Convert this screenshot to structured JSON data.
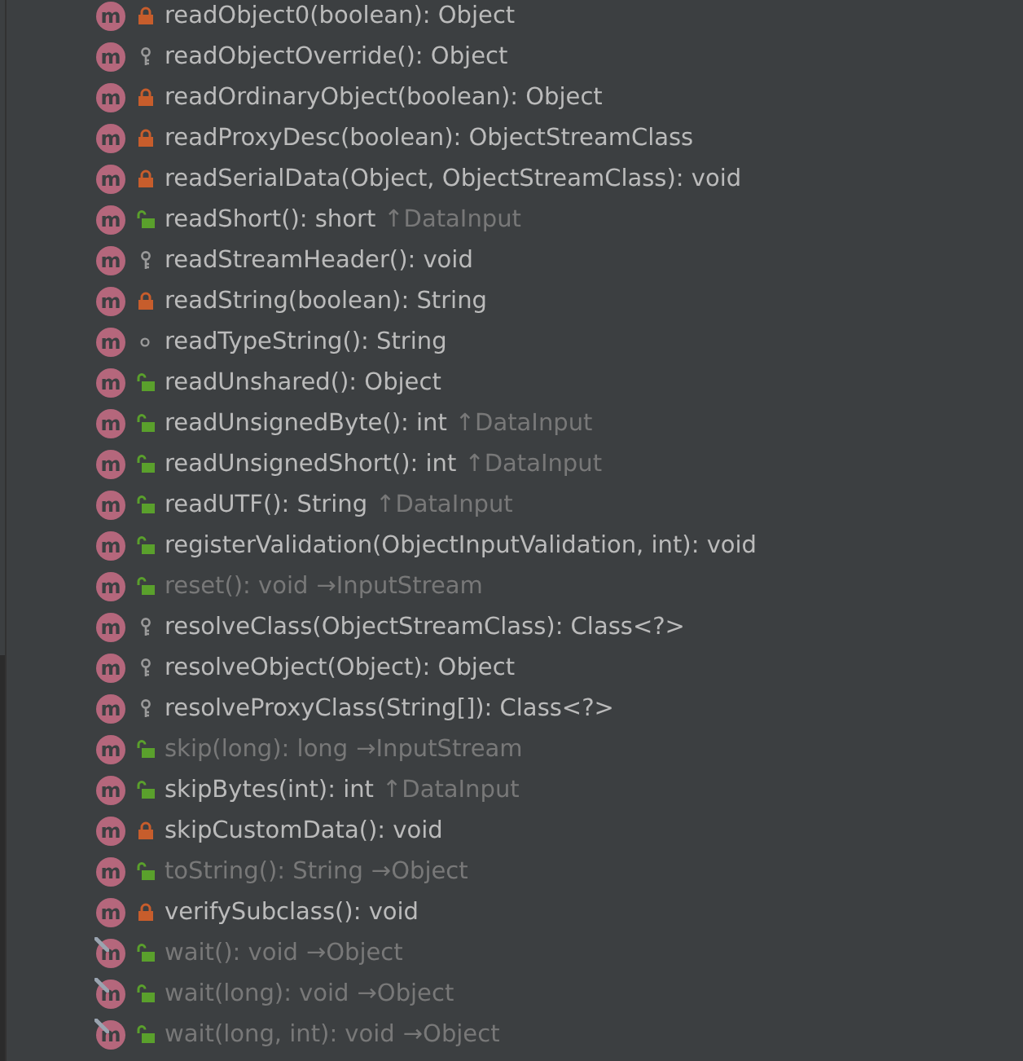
{
  "members": [
    {
      "badge": "m",
      "signature": "readObject0(boolean): Object",
      "kind": "private",
      "inherited": false,
      "final": false
    },
    {
      "badge": "m",
      "signature": "readObjectOverride(): Object",
      "kind": "protected",
      "inherited": false,
      "final": false
    },
    {
      "badge": "m",
      "signature": "readOrdinaryObject(boolean): Object",
      "kind": "private",
      "inherited": false,
      "final": false
    },
    {
      "badge": "m",
      "signature": "readProxyDesc(boolean): ObjectStreamClass",
      "kind": "private",
      "inherited": false,
      "final": false
    },
    {
      "badge": "m",
      "signature": "readSerialData(Object, ObjectStreamClass): void",
      "kind": "private",
      "inherited": false,
      "final": false
    },
    {
      "badge": "m",
      "signature": "readShort(): short",
      "origin": "↑DataInput",
      "kind": "public",
      "inherited": false,
      "final": false
    },
    {
      "badge": "m",
      "signature": "readStreamHeader(): void",
      "kind": "protected",
      "inherited": false,
      "final": false
    },
    {
      "badge": "m",
      "signature": "readString(boolean): String",
      "kind": "private",
      "inherited": false,
      "final": false
    },
    {
      "badge": "m",
      "signature": "readTypeString(): String",
      "kind": "package",
      "inherited": false,
      "final": false
    },
    {
      "badge": "m",
      "signature": "readUnshared(): Object",
      "kind": "public",
      "inherited": false,
      "final": false
    },
    {
      "badge": "m",
      "signature": "readUnsignedByte(): int",
      "origin": "↑DataInput",
      "kind": "public",
      "inherited": false,
      "final": false
    },
    {
      "badge": "m",
      "signature": "readUnsignedShort(): int",
      "origin": "↑DataInput",
      "kind": "public",
      "inherited": false,
      "final": false
    },
    {
      "badge": "m",
      "signature": "readUTF(): String",
      "origin": "↑DataInput",
      "kind": "public",
      "inherited": false,
      "final": false
    },
    {
      "badge": "m",
      "signature": "registerValidation(ObjectInputValidation, int): void",
      "kind": "public",
      "inherited": false,
      "final": false
    },
    {
      "badge": "m",
      "signature": "reset(): void",
      "origin": "→InputStream",
      "kind": "public",
      "inherited": true,
      "final": false
    },
    {
      "badge": "m",
      "signature": "resolveClass(ObjectStreamClass): Class<?>",
      "kind": "protected",
      "inherited": false,
      "final": false
    },
    {
      "badge": "m",
      "signature": "resolveObject(Object): Object",
      "kind": "protected",
      "inherited": false,
      "final": false
    },
    {
      "badge": "m",
      "signature": "resolveProxyClass(String[]): Class<?>",
      "kind": "protected",
      "inherited": false,
      "final": false
    },
    {
      "badge": "m",
      "signature": "skip(long): long",
      "origin": "→InputStream",
      "kind": "public",
      "inherited": true,
      "final": false
    },
    {
      "badge": "m",
      "signature": "skipBytes(int): int",
      "origin": "↑DataInput",
      "kind": "public",
      "inherited": false,
      "final": false
    },
    {
      "badge": "m",
      "signature": "skipCustomData(): void",
      "kind": "private",
      "inherited": false,
      "final": false
    },
    {
      "badge": "m",
      "signature": "toString(): String",
      "origin": "→Object",
      "kind": "public",
      "inherited": true,
      "final": false
    },
    {
      "badge": "m",
      "signature": "verifySubclass(): void",
      "kind": "private",
      "inherited": false,
      "final": false
    },
    {
      "badge": "m",
      "signature": "wait(): void",
      "origin": "→Object",
      "kind": "public",
      "inherited": true,
      "final": true
    },
    {
      "badge": "m",
      "signature": "wait(long): void",
      "origin": "→Object",
      "kind": "public",
      "inherited": true,
      "final": true
    },
    {
      "badge": "m",
      "signature": "wait(long, int): void",
      "origin": "→Object",
      "kind": "public",
      "inherited": true,
      "final": true
    }
  ]
}
